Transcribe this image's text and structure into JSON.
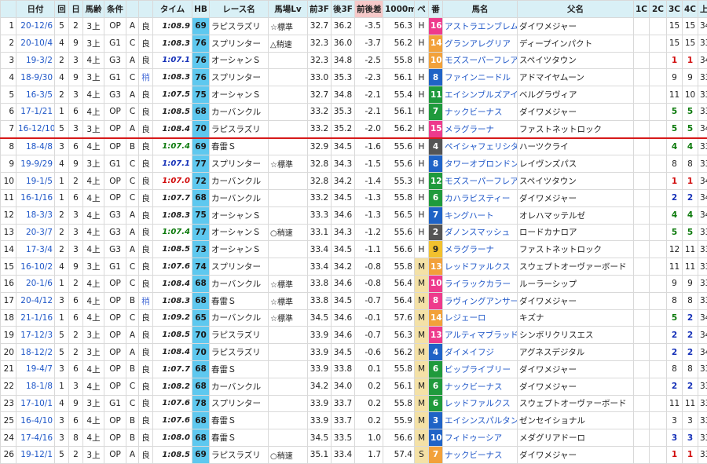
{
  "columns": [
    "",
    "日付",
    "回",
    "日",
    "馬齢",
    "条件",
    "",
    "",
    "タイム",
    "HB",
    "レース名",
    "馬場Lv",
    "前3F",
    "後3F",
    "前後差",
    "1000m",
    "ペ",
    "番",
    "馬名",
    "父名",
    "1C",
    "2C",
    "3C",
    "4C",
    "上り",
    ""
  ],
  "separator_after_row": 7,
  "rows": [
    {
      "no": "1",
      "date": "20-12/6",
      "kai": "5",
      "day": "2",
      "age": "3上",
      "class": "OP",
      "grade": "A",
      "cond": "良",
      "time": "1:08.9",
      "time_style": "",
      "hb": "69",
      "race": "ラピスラズリ",
      "lv": "☆標準",
      "f3": "32.7",
      "l3": "36.2",
      "diff": "-3.5",
      "m1000": "56.3",
      "pace": "H",
      "pace_style": "",
      "num": "16",
      "num_color": "#ee3a8c",
      "horse": "アストラエンブレム",
      "sire": "ダイワメジャー",
      "c1": "",
      "c2": "",
      "c3": "15",
      "c4": "15",
      "c3s": "",
      "c4s": "",
      "agari": "34.6",
      "rank": "1"
    },
    {
      "no": "2",
      "date": "20-10/4",
      "kai": "4",
      "day": "9",
      "age": "3上",
      "class": "G1",
      "grade": "C",
      "cond": "良",
      "time": "1:08.3",
      "time_style": "",
      "hb": "76",
      "race": "スプリンター",
      "lv": "△稍速",
      "f3": "32.3",
      "l3": "36.0",
      "diff": "-3.7",
      "m1000": "56.2",
      "pace": "H",
      "pace_style": "",
      "num": "14",
      "num_color": "#f2a13a",
      "horse": "グランアレグリア",
      "sire": "ディープインパクト",
      "c1": "",
      "c2": "",
      "c3": "15",
      "c4": "15",
      "c3s": "",
      "c4s": "",
      "agari": "33.6",
      "rank": "1"
    },
    {
      "no": "3",
      "date": "19-3/2",
      "kai": "2",
      "day": "3",
      "age": "4上",
      "class": "G3",
      "grade": "A",
      "cond": "良",
      "time": "1:07.1",
      "time_style": "blue",
      "hb": "76",
      "race": "オーシャンＳ",
      "lv": "",
      "f3": "32.3",
      "l3": "34.8",
      "diff": "-2.5",
      "m1000": "55.8",
      "pace": "H",
      "pace_style": "",
      "num": "10",
      "num_color": "#f2a13a",
      "horse": "モズスーパーフレア",
      "sire": "スペイツタウン",
      "c1": "",
      "c2": "",
      "c3": "1",
      "c4": "1",
      "c3s": "red",
      "c4s": "red",
      "agari": "34.6",
      "rank": "9"
    },
    {
      "no": "4",
      "date": "18-9/30",
      "kai": "4",
      "day": "9",
      "age": "3上",
      "class": "G1",
      "grade": "C",
      "cond": "稍",
      "time": "1:08.3",
      "time_style": "",
      "hb": "76",
      "race": "スプリンター",
      "lv": "",
      "f3": "33.0",
      "l3": "35.3",
      "diff": "-2.3",
      "m1000": "56.1",
      "pace": "H",
      "pace_style": "",
      "num": "8",
      "num_color": "#1f63c6",
      "horse": "ファインニードル",
      "sire": "アドマイヤムーン",
      "c1": "",
      "c2": "",
      "c3": "9",
      "c4": "9",
      "c3s": "",
      "c4s": "",
      "agari": "33.6",
      "rank": "3"
    },
    {
      "no": "5",
      "date": "16-3/5",
      "kai": "2",
      "day": "3",
      "age": "4上",
      "class": "G3",
      "grade": "A",
      "cond": "良",
      "time": "1:07.5",
      "time_style": "",
      "hb": "75",
      "race": "オーシャンＳ",
      "lv": "",
      "f3": "32.7",
      "l3": "34.8",
      "diff": "-2.1",
      "m1000": "55.4",
      "pace": "H",
      "pace_style": "",
      "num": "11",
      "num_color": "#1f9a3c",
      "horse": "エイシンブルズアイ",
      "sire": "ベルグラヴィア",
      "c1": "",
      "c2": "",
      "c3": "11",
      "c4": "10",
      "c3s": "",
      "c4s": "",
      "agari": "33.6",
      "rank": "1"
    },
    {
      "no": "6",
      "date": "17-1/21",
      "kai": "1",
      "day": "6",
      "age": "4上",
      "class": "OP",
      "grade": "C",
      "cond": "良",
      "time": "1:08.5",
      "time_style": "",
      "hb": "68",
      "race": "カーバンクル",
      "lv": "",
      "f3": "33.2",
      "l3": "35.3",
      "diff": "-2.1",
      "m1000": "56.1",
      "pace": "H",
      "pace_style": "",
      "num": "7",
      "num_color": "#1f9a3c",
      "horse": "ナックビーナス",
      "sire": "ダイワメジャー",
      "c1": "",
      "c2": "",
      "c3": "5",
      "c4": "5",
      "c3s": "green",
      "c4s": "green",
      "agari": "33.6",
      "rank": "2"
    },
    {
      "no": "7",
      "date": "16-12/10",
      "kai": "5",
      "day": "3",
      "age": "3上",
      "class": "OP",
      "grade": "A",
      "cond": "良",
      "time": "1:08.4",
      "time_style": "",
      "hb": "70",
      "race": "ラピスラズリ",
      "lv": "",
      "f3": "33.2",
      "l3": "35.2",
      "diff": "-2.0",
      "m1000": "56.2",
      "pace": "H",
      "pace_style": "",
      "num": "15",
      "num_color": "#ee3a8c",
      "horse": "メラグラーナ",
      "sire": "ファストネットロック",
      "c1": "",
      "c2": "",
      "c3": "5",
      "c4": "5",
      "c3s": "green",
      "c4s": "green",
      "agari": "34.9",
      "rank": "2"
    },
    {
      "no": "8",
      "date": "18-4/8",
      "kai": "3",
      "day": "6",
      "age": "4上",
      "class": "OP",
      "grade": "B",
      "cond": "良",
      "time": "1:07.4",
      "time_style": "green",
      "hb": "69",
      "race": "春雷Ｓ",
      "lv": "",
      "f3": "32.9",
      "l3": "34.5",
      "diff": "-1.6",
      "m1000": "55.6",
      "pace": "H",
      "pace_style": "",
      "num": "4",
      "num_color": "#555555",
      "horse": "ペイシャフェリシタ",
      "sire": "ハーツクライ",
      "c1": "",
      "c2": "",
      "c3": "4",
      "c4": "4",
      "c3s": "green",
      "c4s": "green",
      "agari": "33.6",
      "rank": "5"
    },
    {
      "no": "9",
      "date": "19-9/29",
      "kai": "4",
      "day": "9",
      "age": "3上",
      "class": "G1",
      "grade": "C",
      "cond": "良",
      "time": "1:07.1",
      "time_style": "blue",
      "hb": "77",
      "race": "スプリンター",
      "lv": "☆標準",
      "f3": "32.8",
      "l3": "34.3",
      "diff": "-1.5",
      "m1000": "55.6",
      "pace": "H",
      "pace_style": "",
      "num": "8",
      "num_color": "#1f63c6",
      "horse": "タワーオブロンドン",
      "sire": "レイヴンズパス",
      "c1": "",
      "c2": "",
      "c3": "8",
      "c4": "8",
      "c3s": "",
      "c4s": "",
      "agari": "33.5",
      "rank": "1"
    },
    {
      "no": "10",
      "date": "19-1/5",
      "kai": "1",
      "day": "2",
      "age": "4上",
      "class": "OP",
      "grade": "C",
      "cond": "良",
      "time": "1:07.0",
      "time_style": "red",
      "hb": "72",
      "race": "カーバンクル",
      "lv": "",
      "f3": "32.8",
      "l3": "34.2",
      "diff": "-1.4",
      "m1000": "55.3",
      "pace": "H",
      "pace_style": "",
      "num": "12",
      "num_color": "#1f9a3c",
      "horse": "モズスーパーフレア",
      "sire": "スペイツタウン",
      "c1": "",
      "c2": "",
      "c3": "1",
      "c4": "1",
      "c3s": "red",
      "c4s": "red",
      "agari": "34.2",
      "rank": "1"
    },
    {
      "no": "11",
      "date": "16-1/16",
      "kai": "1",
      "day": "6",
      "age": "4上",
      "class": "OP",
      "grade": "C",
      "cond": "良",
      "time": "1:07.7",
      "time_style": "",
      "hb": "68",
      "race": "カーバンクル",
      "lv": "",
      "f3": "33.2",
      "l3": "34.5",
      "diff": "-1.3",
      "m1000": "55.8",
      "pace": "H",
      "pace_style": "",
      "num": "6",
      "num_color": "#1f9a3c",
      "horse": "カハラビスティー",
      "sire": "ダイワメジャー",
      "c1": "",
      "c2": "",
      "c3": "2",
      "c4": "2",
      "c3s": "blue",
      "c4s": "blue",
      "agari": "34.3",
      "rank": "1"
    },
    {
      "no": "12",
      "date": "18-3/3",
      "kai": "2",
      "day": "3",
      "age": "4上",
      "class": "G3",
      "grade": "A",
      "cond": "良",
      "time": "1:08.3",
      "time_style": "",
      "hb": "75",
      "race": "オーシャンＳ",
      "lv": "",
      "f3": "33.3",
      "l3": "34.6",
      "diff": "-1.3",
      "m1000": "56.5",
      "pace": "H",
      "pace_style": "",
      "num": "7",
      "num_color": "#1f63c6",
      "horse": "キングハート",
      "sire": "オレハマッテルゼ",
      "c1": "",
      "c2": "",
      "c3": "4",
      "c4": "4",
      "c3s": "green",
      "c4s": "green",
      "agari": "34.0",
      "rank": "1"
    },
    {
      "no": "13",
      "date": "20-3/7",
      "kai": "2",
      "day": "3",
      "age": "4上",
      "class": "G3",
      "grade": "A",
      "cond": "良",
      "time": "1:07.4",
      "time_style": "green",
      "hb": "77",
      "race": "オーシャンＳ",
      "lv": "○稍速",
      "f3": "33.1",
      "l3": "34.3",
      "diff": "-1.2",
      "m1000": "55.6",
      "pace": "H",
      "pace_style": "",
      "num": "2",
      "num_color": "#555555",
      "horse": "ダノンスマッシュ",
      "sire": "ロードカナロア",
      "c1": "",
      "c2": "",
      "c3": "5",
      "c4": "5",
      "c3s": "green",
      "c4s": "green",
      "agari": "33.6",
      "rank": "1"
    },
    {
      "no": "14",
      "date": "17-3/4",
      "kai": "2",
      "day": "3",
      "age": "4上",
      "class": "G3",
      "grade": "A",
      "cond": "良",
      "time": "1:08.5",
      "time_style": "",
      "hb": "73",
      "race": "オーシャンＳ",
      "lv": "",
      "f3": "33.4",
      "l3": "34.5",
      "diff": "-1.1",
      "m1000": "56.6",
      "pace": "H",
      "pace_style": "",
      "num": "9",
      "num_color": "#f2c12e",
      "horse": "メラグラーナ",
      "sire": "ファストネットロック",
      "c1": "",
      "c2": "",
      "c3": "12",
      "c4": "11",
      "c3s": "",
      "c4s": "",
      "agari": "33.6",
      "rank": "1"
    },
    {
      "no": "15",
      "date": "16-10/2",
      "kai": "4",
      "day": "9",
      "age": "3上",
      "class": "G1",
      "grade": "C",
      "cond": "良",
      "time": "1:07.6",
      "time_style": "",
      "hb": "74",
      "race": "スプリンター",
      "lv": "",
      "f3": "33.4",
      "l3": "34.2",
      "diff": "-0.8",
      "m1000": "55.8",
      "pace": "M",
      "pace_style": "s",
      "num": "13",
      "num_color": "#f2a13a",
      "horse": "レッドファルクス",
      "sire": "スウェプトオーヴァーボード",
      "c1": "",
      "c2": "",
      "c3": "11",
      "c4": "11",
      "c3s": "",
      "c4s": "",
      "agari": "33.5",
      "rank": "1"
    },
    {
      "no": "16",
      "date": "20-1/6",
      "kai": "1",
      "day": "2",
      "age": "4上",
      "class": "OP",
      "grade": "C",
      "cond": "良",
      "time": "1:08.4",
      "time_style": "",
      "hb": "68",
      "race": "カーバンクル",
      "lv": "☆標準",
      "f3": "33.8",
      "l3": "34.6",
      "diff": "-0.8",
      "m1000": "56.4",
      "pace": "M",
      "pace_style": "s",
      "num": "10",
      "num_color": "#ee3a8c",
      "horse": "ライラックカラー",
      "sire": "ルーラーシップ",
      "c1": "",
      "c2": "",
      "c3": "9",
      "c4": "9",
      "c3s": "",
      "c4s": "",
      "agari": "33.9",
      "rank": "1"
    },
    {
      "no": "17",
      "date": "20-4/12",
      "kai": "3",
      "day": "6",
      "age": "4上",
      "class": "OP",
      "grade": "B",
      "cond": "稍",
      "time": "1:08.3",
      "time_style": "",
      "hb": "68",
      "race": "春雷Ｓ",
      "lv": "☆標準",
      "f3": "33.8",
      "l3": "34.5",
      "diff": "-0.7",
      "m1000": "56.4",
      "pace": "M",
      "pace_style": "s",
      "num": "8",
      "num_color": "#ee3a8c",
      "horse": "ラヴィングアンサー",
      "sire": "ダイワメジャー",
      "c1": "",
      "c2": "",
      "c3": "8",
      "c4": "8",
      "c3s": "",
      "c4s": "",
      "agari": "33.6",
      "rank": "2"
    },
    {
      "no": "18",
      "date": "21-1/16",
      "kai": "1",
      "day": "6",
      "age": "4上",
      "class": "OP",
      "grade": "C",
      "cond": "良",
      "time": "1:09.2",
      "time_style": "",
      "hb": "65",
      "race": "カーバンクル",
      "lv": "☆標準",
      "f3": "34.5",
      "l3": "34.6",
      "diff": "-0.1",
      "m1000": "57.6",
      "pace": "M",
      "pace_style": "s",
      "num": "14",
      "num_color": "#f2a13a",
      "horse": "レジェーロ",
      "sire": "キズナ",
      "c1": "",
      "c2": "",
      "c3": "5",
      "c4": "2",
      "c3s": "green",
      "c4s": "blue",
      "agari": "34.3",
      "rank": "2"
    },
    {
      "no": "19",
      "date": "17-12/3",
      "kai": "5",
      "day": "2",
      "age": "3上",
      "class": "OP",
      "grade": "A",
      "cond": "良",
      "time": "1:08.5",
      "time_style": "",
      "hb": "70",
      "race": "ラピスラズリ",
      "lv": "",
      "f3": "33.9",
      "l3": "34.6",
      "diff": "-0.7",
      "m1000": "56.3",
      "pace": "M",
      "pace_style": "s",
      "num": "13",
      "num_color": "#ee3a8c",
      "horse": "アルティマブラッド",
      "sire": "シンボリクリスエス",
      "c1": "",
      "c2": "",
      "c3": "2",
      "c4": "2",
      "c3s": "blue",
      "c4s": "blue",
      "agari": "34.6",
      "rank": "2"
    },
    {
      "no": "20",
      "date": "18-12/2",
      "kai": "5",
      "day": "2",
      "age": "3上",
      "class": "OP",
      "grade": "A",
      "cond": "良",
      "time": "1:08.4",
      "time_style": "",
      "hb": "70",
      "race": "ラピスラズリ",
      "lv": "",
      "f3": "33.9",
      "l3": "34.5",
      "diff": "-0.6",
      "m1000": "56.2",
      "pace": "M",
      "pace_style": "s",
      "num": "4",
      "num_color": "#1f63c6",
      "horse": "ダイメイフジ",
      "sire": "アグネスデジタル",
      "c1": "",
      "c2": "",
      "c3": "2",
      "c4": "2",
      "c3s": "blue",
      "c4s": "blue",
      "agari": "34.3",
      "rank": "1"
    },
    {
      "no": "21",
      "date": "19-4/7",
      "kai": "3",
      "day": "6",
      "age": "4上",
      "class": "OP",
      "grade": "B",
      "cond": "良",
      "time": "1:07.7",
      "time_style": "",
      "hb": "68",
      "race": "春雷Ｓ",
      "lv": "",
      "f3": "33.9",
      "l3": "33.8",
      "diff": "0.1",
      "m1000": "55.8",
      "pace": "M",
      "pace_style": "s",
      "num": "6",
      "num_color": "#1f9a3c",
      "horse": "ビップライブリー",
      "sire": "ダイワメジャー",
      "c1": "",
      "c2": "",
      "c3": "8",
      "c4": "8",
      "c3s": "",
      "c4s": "",
      "agari": "33.6",
      "rank": "1"
    },
    {
      "no": "22",
      "date": "18-1/8",
      "kai": "1",
      "day": "3",
      "age": "4上",
      "class": "OP",
      "grade": "C",
      "cond": "良",
      "time": "1:08.2",
      "time_style": "",
      "hb": "68",
      "race": "カーバンクル",
      "lv": "",
      "f3": "34.2",
      "l3": "34.0",
      "diff": "0.2",
      "m1000": "56.1",
      "pace": "M",
      "pace_style": "s",
      "num": "6",
      "num_color": "#1f9a3c",
      "horse": "ナックビーナス",
      "sire": "ダイワメジャー",
      "c1": "",
      "c2": "",
      "c3": "2",
      "c4": "2",
      "c3s": "blue",
      "c4s": "blue",
      "agari": "33.9",
      "rank": "1"
    },
    {
      "no": "23",
      "date": "17-10/1",
      "kai": "4",
      "day": "9",
      "age": "3上",
      "class": "G1",
      "grade": "C",
      "cond": "良",
      "time": "1:07.6",
      "time_style": "",
      "hb": "78",
      "race": "スプリンター",
      "lv": "",
      "f3": "33.9",
      "l3": "33.7",
      "diff": "0.2",
      "m1000": "55.8",
      "pace": "M",
      "pace_style": "s",
      "num": "6",
      "num_color": "#1f9a3c",
      "horse": "レッドファルクス",
      "sire": "スウェプトオーヴァーボード",
      "c1": "",
      "c2": "",
      "c3": "11",
      "c4": "11",
      "c3s": "",
      "c4s": "",
      "agari": "33.0",
      "rank": "1"
    },
    {
      "no": "25",
      "date": "16-4/10",
      "kai": "3",
      "day": "6",
      "age": "4上",
      "class": "OP",
      "grade": "B",
      "cond": "良",
      "time": "1:07.6",
      "time_style": "",
      "hb": "68",
      "race": "春雷Ｓ",
      "lv": "",
      "f3": "33.9",
      "l3": "33.7",
      "diff": "0.2",
      "m1000": "55.9",
      "pace": "M",
      "pace_style": "s",
      "num": "3",
      "num_color": "#1f63c6",
      "horse": "エイシンスパルタン",
      "sire": "ゼンセイショナル",
      "c1": "",
      "c2": "",
      "c3": "3",
      "c4": "3",
      "c3s": "",
      "c4s": "",
      "agari": "33.6",
      "rank": "2"
    },
    {
      "no": "24",
      "date": "17-4/16",
      "kai": "3",
      "day": "8",
      "age": "4上",
      "class": "OP",
      "grade": "B",
      "cond": "良",
      "time": "1:08.0",
      "time_style": "",
      "hb": "68",
      "race": "春雷Ｓ",
      "lv": "",
      "f3": "34.5",
      "l3": "33.5",
      "diff": "1.0",
      "m1000": "56.6",
      "pace": "M",
      "pace_style": "s",
      "num": "10",
      "num_color": "#1f63c6",
      "horse": "フィドゥーシア",
      "sire": "メダグリアドーロ",
      "c1": "",
      "c2": "",
      "c3": "3",
      "c4": "3",
      "c3s": "blue",
      "c4s": "blue",
      "agari": "33.3",
      "rank": "1"
    },
    {
      "no": "26",
      "date": "19-12/1",
      "kai": "5",
      "day": "2",
      "age": "3上",
      "class": "OP",
      "grade": "A",
      "cond": "良",
      "time": "1:08.5",
      "time_style": "",
      "hb": "69",
      "race": "ラピスラズリ",
      "lv": "○稍速",
      "f3": "35.1",
      "l3": "33.4",
      "diff": "1.7",
      "m1000": "57.4",
      "pace": "S",
      "pace_style": "s",
      "num": "7",
      "num_color": "#f2a13a",
      "horse": "ナックビーナス",
      "sire": "ダイワメジャー",
      "c1": "",
      "c2": "",
      "c3": "1",
      "c4": "1",
      "c3s": "red",
      "c4s": "red",
      "agari": "33.4",
      "rank": "1"
    }
  ]
}
